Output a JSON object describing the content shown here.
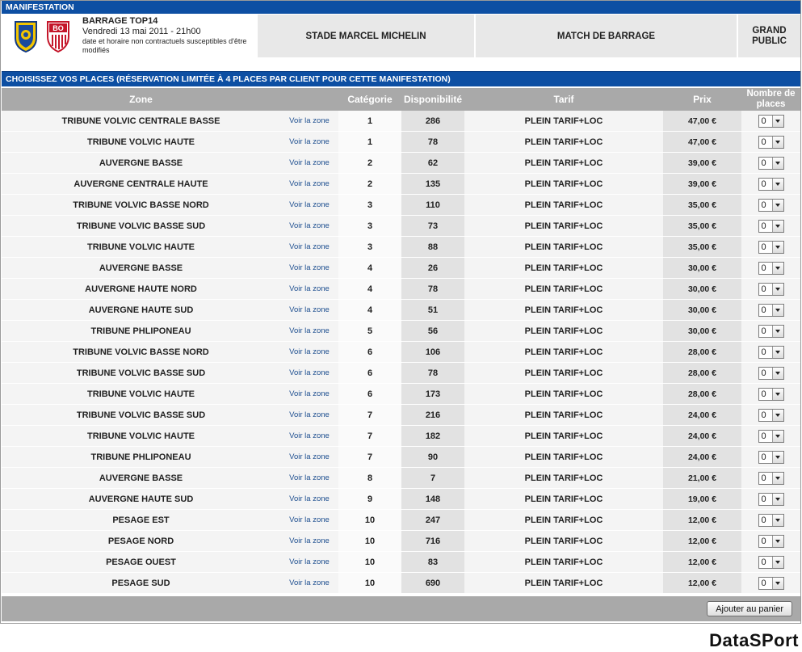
{
  "header_bar": "MANIFESTATION",
  "event": {
    "title": "BARRAGE TOP14",
    "date": "Vendredi 13 mai 2011 - 21h00",
    "note": "date et horaire non contractuels susceptibles d'être modifiés",
    "venue": "STADE MARCEL MICHELIN",
    "type": "MATCH DE BARRAGE",
    "audience": "GRAND PUBLIC",
    "logo_left_icon": "asm-clermont-crest",
    "logo_right_icon": "bo-biarritz-crest"
  },
  "section_bar": "CHOISISSEZ VOS PLACES (RÉSERVATION LIMITÉE À 4 PLACES PAR CLIENT POUR CETTE MANIFESTATION)",
  "columns": {
    "zone": "Zone",
    "category": "Catégorie",
    "availability": "Disponibilité",
    "tariff": "Tarif",
    "price": "Prix",
    "places": "Nombre de places"
  },
  "rows": [
    {
      "zone": "TRIBUNE VOLVIC CENTRALE BASSE",
      "link": "Voir la zone",
      "cat": "1",
      "dispo": "286",
      "tarif": "PLEIN TARIF+LOC",
      "prix": "47,00 €",
      "qty": "0"
    },
    {
      "zone": "TRIBUNE VOLVIC HAUTE",
      "link": "Voir la zone",
      "cat": "1",
      "dispo": "78",
      "tarif": "PLEIN TARIF+LOC",
      "prix": "47,00 €",
      "qty": "0"
    },
    {
      "zone": "AUVERGNE BASSE",
      "link": "Voir la zone",
      "cat": "2",
      "dispo": "62",
      "tarif": "PLEIN TARIF+LOC",
      "prix": "39,00 €",
      "qty": "0"
    },
    {
      "zone": "AUVERGNE CENTRALE HAUTE",
      "link": "Voir la zone",
      "cat": "2",
      "dispo": "135",
      "tarif": "PLEIN TARIF+LOC",
      "prix": "39,00 €",
      "qty": "0"
    },
    {
      "zone": "TRIBUNE VOLVIC BASSE NORD",
      "link": "Voir la zone",
      "cat": "3",
      "dispo": "110",
      "tarif": "PLEIN TARIF+LOC",
      "prix": "35,00 €",
      "qty": "0"
    },
    {
      "zone": "TRIBUNE VOLVIC BASSE SUD",
      "link": "Voir la zone",
      "cat": "3",
      "dispo": "73",
      "tarif": "PLEIN TARIF+LOC",
      "prix": "35,00 €",
      "qty": "0"
    },
    {
      "zone": "TRIBUNE VOLVIC HAUTE",
      "link": "Voir la zone",
      "cat": "3",
      "dispo": "88",
      "tarif": "PLEIN TARIF+LOC",
      "prix": "35,00 €",
      "qty": "0"
    },
    {
      "zone": "AUVERGNE BASSE",
      "link": "Voir la zone",
      "cat": "4",
      "dispo": "26",
      "tarif": "PLEIN TARIF+LOC",
      "prix": "30,00 €",
      "qty": "0"
    },
    {
      "zone": "AUVERGNE HAUTE NORD",
      "link": "Voir la zone",
      "cat": "4",
      "dispo": "78",
      "tarif": "PLEIN TARIF+LOC",
      "prix": "30,00 €",
      "qty": "0"
    },
    {
      "zone": "AUVERGNE HAUTE SUD",
      "link": "Voir la zone",
      "cat": "4",
      "dispo": "51",
      "tarif": "PLEIN TARIF+LOC",
      "prix": "30,00 €",
      "qty": "0"
    },
    {
      "zone": "TRIBUNE PHLIPONEAU",
      "link": "Voir la zone",
      "cat": "5",
      "dispo": "56",
      "tarif": "PLEIN TARIF+LOC",
      "prix": "30,00 €",
      "qty": "0"
    },
    {
      "zone": "TRIBUNE VOLVIC BASSE NORD",
      "link": "Voir la zone",
      "cat": "6",
      "dispo": "106",
      "tarif": "PLEIN TARIF+LOC",
      "prix": "28,00 €",
      "qty": "0"
    },
    {
      "zone": "TRIBUNE VOLVIC BASSE SUD",
      "link": "Voir la zone",
      "cat": "6",
      "dispo": "78",
      "tarif": "PLEIN TARIF+LOC",
      "prix": "28,00 €",
      "qty": "0"
    },
    {
      "zone": "TRIBUNE VOLVIC HAUTE",
      "link": "Voir la zone",
      "cat": "6",
      "dispo": "173",
      "tarif": "PLEIN TARIF+LOC",
      "prix": "28,00 €",
      "qty": "0"
    },
    {
      "zone": "TRIBUNE VOLVIC BASSE SUD",
      "link": "Voir la zone",
      "cat": "7",
      "dispo": "216",
      "tarif": "PLEIN TARIF+LOC",
      "prix": "24,00 €",
      "qty": "0"
    },
    {
      "zone": "TRIBUNE VOLVIC HAUTE",
      "link": "Voir la zone",
      "cat": "7",
      "dispo": "182",
      "tarif": "PLEIN TARIF+LOC",
      "prix": "24,00 €",
      "qty": "0"
    },
    {
      "zone": "TRIBUNE PHLIPONEAU",
      "link": "Voir la zone",
      "cat": "7",
      "dispo": "90",
      "tarif": "PLEIN TARIF+LOC",
      "prix": "24,00 €",
      "qty": "0"
    },
    {
      "zone": "AUVERGNE BASSE",
      "link": "Voir la zone",
      "cat": "8",
      "dispo": "7",
      "tarif": "PLEIN TARIF+LOC",
      "prix": "21,00 €",
      "qty": "0"
    },
    {
      "zone": "AUVERGNE HAUTE SUD",
      "link": "Voir la zone",
      "cat": "9",
      "dispo": "148",
      "tarif": "PLEIN TARIF+LOC",
      "prix": "19,00 €",
      "qty": "0"
    },
    {
      "zone": "PESAGE EST",
      "link": "Voir la zone",
      "cat": "10",
      "dispo": "247",
      "tarif": "PLEIN TARIF+LOC",
      "prix": "12,00 €",
      "qty": "0"
    },
    {
      "zone": "PESAGE NORD",
      "link": "Voir la zone",
      "cat": "10",
      "dispo": "716",
      "tarif": "PLEIN TARIF+LOC",
      "prix": "12,00 €",
      "qty": "0"
    },
    {
      "zone": "PESAGE OUEST",
      "link": "Voir la zone",
      "cat": "10",
      "dispo": "83",
      "tarif": "PLEIN TARIF+LOC",
      "prix": "12,00 €",
      "qty": "0"
    },
    {
      "zone": "PESAGE SUD",
      "link": "Voir la zone",
      "cat": "10",
      "dispo": "690",
      "tarif": "PLEIN TARIF+LOC",
      "prix": "12,00 €",
      "qty": "0"
    }
  ],
  "add_button": "Ajouter au panier",
  "brand": "DataSPort",
  "colors": {
    "bar_blue": "#0d4fa3",
    "header_grey": "#a9a9a9"
  }
}
